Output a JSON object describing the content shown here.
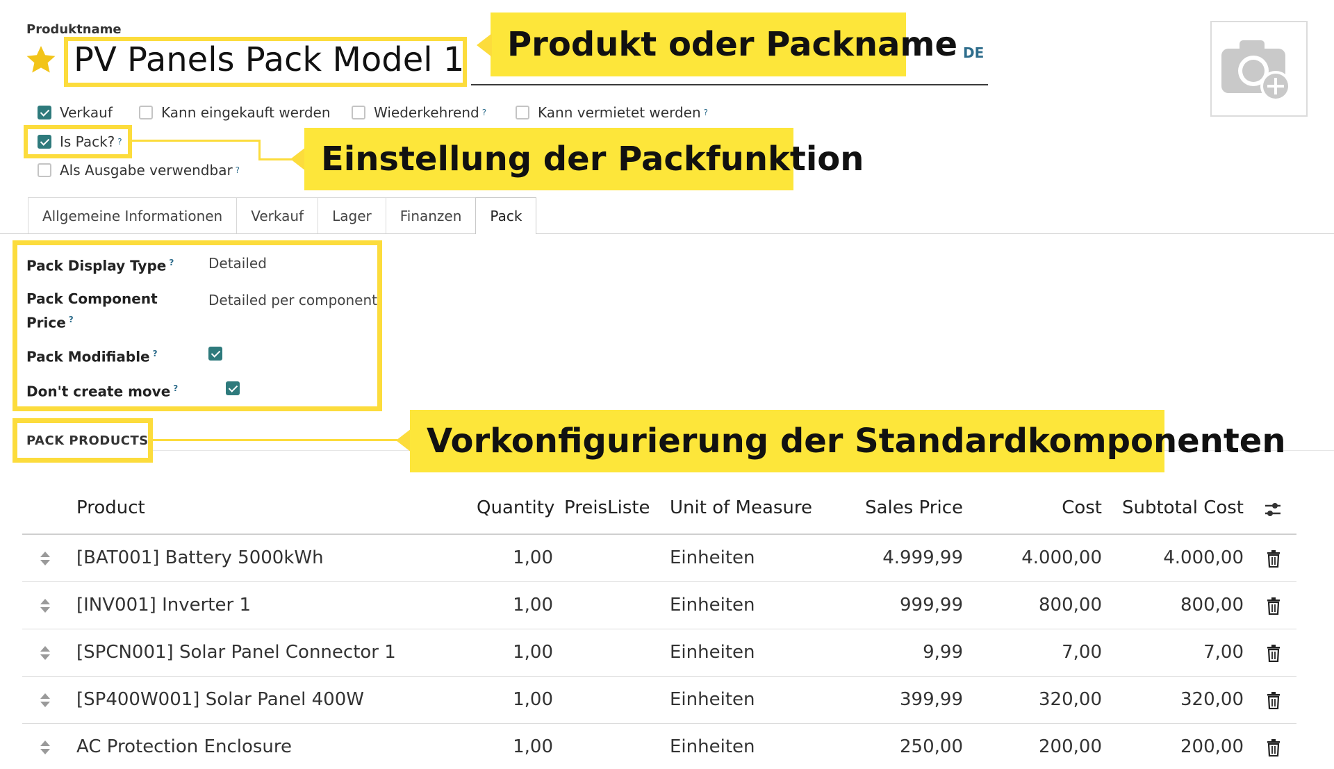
{
  "header": {
    "field_label": "Produktname",
    "product_name": "PV Panels Pack Model 1",
    "language": "DE"
  },
  "callouts": {
    "name": "Produkt oder Packname",
    "pack_setting": "Einstellung der Packfunktion",
    "components": "Vorkonfigurierung der Standardkomponenten"
  },
  "options": {
    "verkauf": {
      "label": "Verkauf",
      "checked": true
    },
    "einkauf": {
      "label": "Kann eingekauft werden",
      "checked": false
    },
    "wiederkehrend": {
      "label": "Wiederkehrend",
      "checked": false
    },
    "vermietet": {
      "label": "Kann vermietet werden",
      "checked": false
    },
    "is_pack": {
      "label": "Is Pack?",
      "checked": true
    },
    "ausgabe": {
      "label": "Als Ausgabe verwendbar",
      "checked": false
    },
    "help": "?"
  },
  "tabs": [
    "Allgemeine Informationen",
    "Verkauf",
    "Lager",
    "Finanzen",
    "Pack"
  ],
  "active_tab": "Pack",
  "pack_settings": {
    "display_type_label": "Pack Display Type",
    "display_type_value": "Detailed",
    "component_price_label_1": "Pack Component",
    "component_price_label_2": "Price",
    "component_price_value": "Detailed per component",
    "modifiable_label": "Pack Modifiable",
    "modifiable": true,
    "no_move_label": "Don't create move",
    "no_move": true
  },
  "section_title": "PACK PRODUCTS",
  "table": {
    "columns": {
      "product": "Product",
      "quantity": "Quantity",
      "pricelist": "PreisListe",
      "uom": "Unit of Measure",
      "sales_price": "Sales Price",
      "cost": "Cost",
      "subtotal": "Subtotal Cost"
    },
    "rows": [
      {
        "product": "[BAT001] Battery 5000kWh",
        "quantity": "1,00",
        "uom": "Einheiten",
        "sales_price": "4.999,99",
        "cost": "4.000,00",
        "subtotal": "4.000,00"
      },
      {
        "product": "[INV001] Inverter 1",
        "quantity": "1,00",
        "uom": "Einheiten",
        "sales_price": "999,99",
        "cost": "800,00",
        "subtotal": "800,00"
      },
      {
        "product": "[SPCN001] Solar Panel Connector 1",
        "quantity": "1,00",
        "uom": "Einheiten",
        "sales_price": "9,99",
        "cost": "7,00",
        "subtotal": "7,00"
      },
      {
        "product": "[SP400W001] Solar Panel 400W",
        "quantity": "1,00",
        "uom": "Einheiten",
        "sales_price": "399,99",
        "cost": "320,00",
        "subtotal": "320,00"
      },
      {
        "product": "AC Protection Enclosure",
        "quantity": "1,00",
        "uom": "Einheiten",
        "sales_price": "250,00",
        "cost": "200,00",
        "subtotal": "200,00"
      }
    ]
  },
  "colors": {
    "highlight": "#fcdc3c",
    "callout": "#fde63a",
    "checkbox": "#2e7a7c",
    "link": "#2e6d8c"
  }
}
